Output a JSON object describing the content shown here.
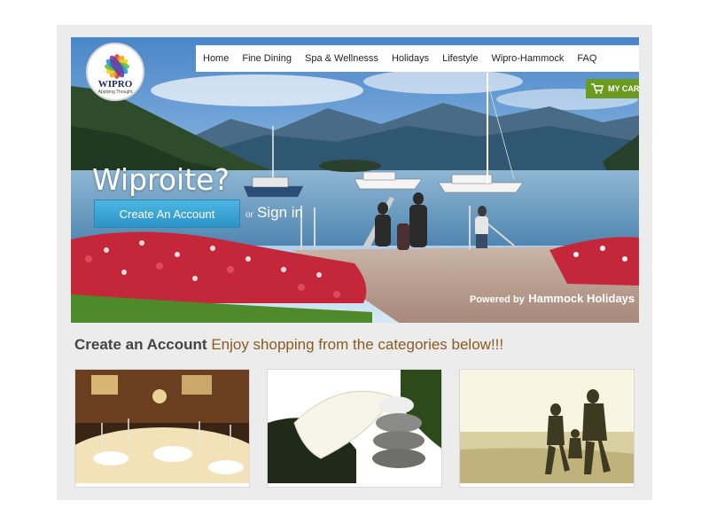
{
  "logo": {
    "brand": "WIPRO",
    "tagline": "Applying Thought"
  },
  "nav": {
    "items": [
      "Home",
      "Fine Dining",
      "Spa & Wellnesss",
      "Holidays",
      "Lifestyle",
      "Wipro-Hammock",
      "FAQ"
    ]
  },
  "cart": {
    "label": "MY CART",
    "icon": "cart-icon"
  },
  "hero": {
    "title": "Wiproite?",
    "create_button": "Create An Account",
    "or_text": "or",
    "signin_link": "Sign in",
    "powered_prefix": "Powered by",
    "powered_brand": "Hammock Holidays"
  },
  "section": {
    "title": "Create an Account",
    "subtitle": "Enjoy shopping from the categories below!!!"
  },
  "colors": {
    "cart_green": "#6a9a1f",
    "button_blue": "#3aa6d8",
    "subtitle_brown": "#8a5a1e",
    "frame_gray": "#ececec"
  }
}
